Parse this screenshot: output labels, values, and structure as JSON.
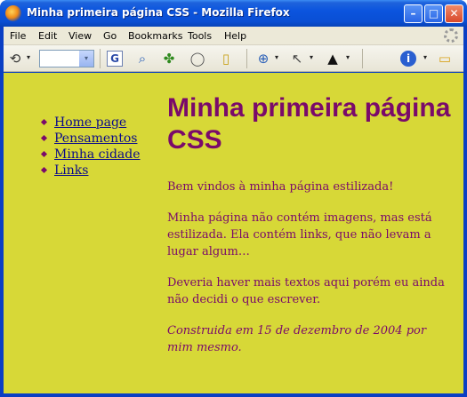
{
  "window": {
    "title": "Minha primeira página CSS - Mozilla Firefox",
    "minimize_label": "–",
    "maximize_label": "□",
    "close_label": "✕"
  },
  "menubar": {
    "items": [
      {
        "label": "File"
      },
      {
        "label": "Edit"
      },
      {
        "label": "View"
      },
      {
        "label": "Go"
      },
      {
        "label": "Bookmarks"
      },
      {
        "label": "Tools"
      },
      {
        "label": "Help"
      }
    ]
  },
  "toolbar": {
    "icons": [
      "back-icon",
      "combo-box",
      "google-icon",
      "find-icon",
      "clover-icon",
      "speech-bubble-icon",
      "book-icon",
      "zoom-icon",
      "pointer-icon",
      "graduation-cap-icon",
      "info-icon",
      "folder-icon"
    ],
    "back_glyph": "⟲",
    "google_glyph": "G",
    "find_glyph": "⌕",
    "clover_glyph": "✤",
    "bubble_glyph": "◯",
    "book_glyph": "▯",
    "zoom_glyph": "⊕",
    "pointer_glyph": "↖",
    "cap_glyph": "▲",
    "info_glyph": "i",
    "folder_glyph": "▭",
    "dropdown_glyph": "▾"
  },
  "page": {
    "nav": [
      {
        "label": "Home page"
      },
      {
        "label": "Pensamentos"
      },
      {
        "label": "Minha cidade"
      },
      {
        "label": "Links"
      }
    ],
    "heading": "Minha primeira página CSS",
    "paragraphs": [
      "Bem vindos à minha página estilizada!",
      "Minha página não contém imagens, mas está estilizada. Ela contém links, que não levam a lugar algum…",
      "Deveria haver mais textos aqui porém eu ainda não decidi o que escrever."
    ],
    "signature": "Construida em 15 de dezembro de 2004 por mim mesmo."
  },
  "colors": {
    "background": "#d7d837",
    "text": "#7a0a6a",
    "link": "#0a0a8a",
    "titlebar": "#0a4fd4"
  }
}
